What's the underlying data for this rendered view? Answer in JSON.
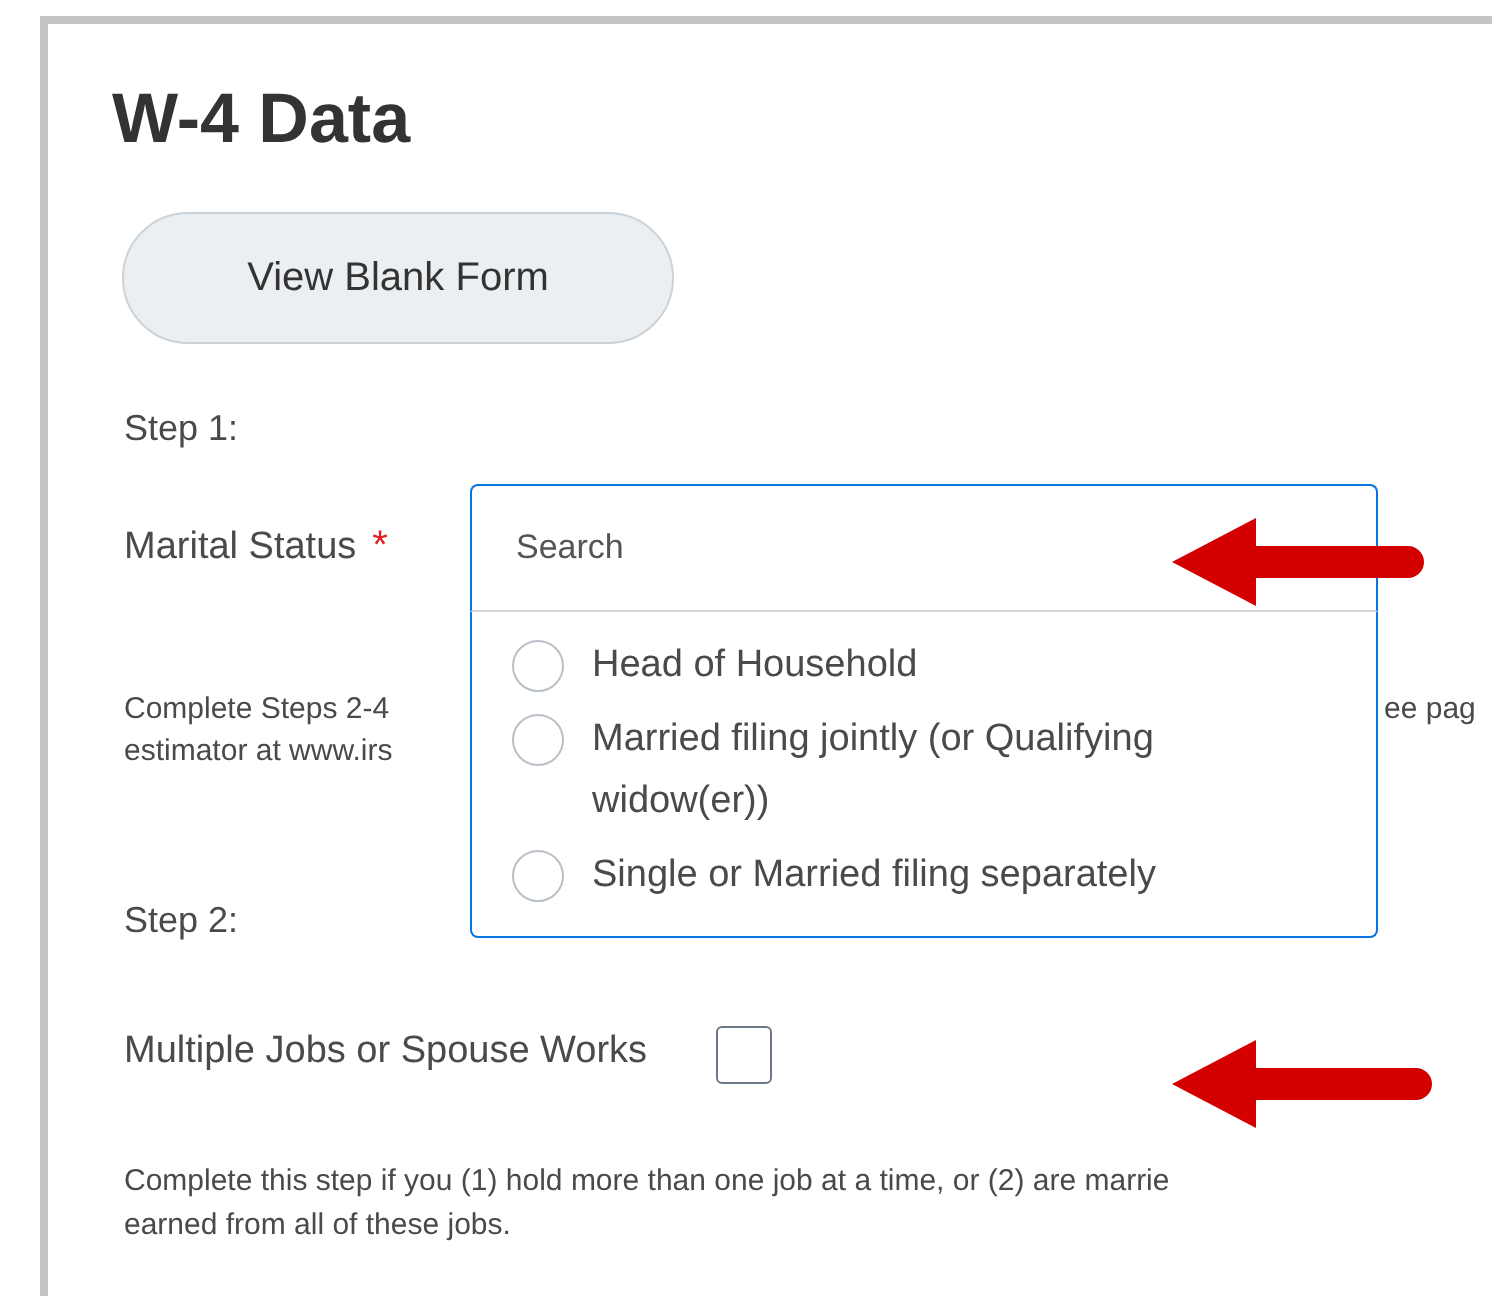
{
  "title": "W-4 Data",
  "view_button": "View Blank Form",
  "step1": {
    "heading": "Step 1:",
    "field_label": "Marital Status",
    "required_mark": "*",
    "placeholder": "Search",
    "options": [
      {
        "label": "Head of Household",
        "selected": false
      },
      {
        "label": "Married filing jointly (or Qualifying widow(er))",
        "selected": false
      },
      {
        "label": "Single or Married filing separately",
        "selected": false
      }
    ],
    "note_lines": [
      {
        "left": "Complete Steps 2-4",
        "right": "ee pag"
      },
      {
        "left": "estimator at www.irs"
      }
    ]
  },
  "step2": {
    "heading": "Step 2:",
    "checkbox_label": "Multiple Jobs or Spouse Works",
    "checked": false,
    "note_lines": [
      "Complete this step if you (1) hold more than one job at a time, or (2) are marrie",
      "earned from all of these jobs."
    ]
  }
}
